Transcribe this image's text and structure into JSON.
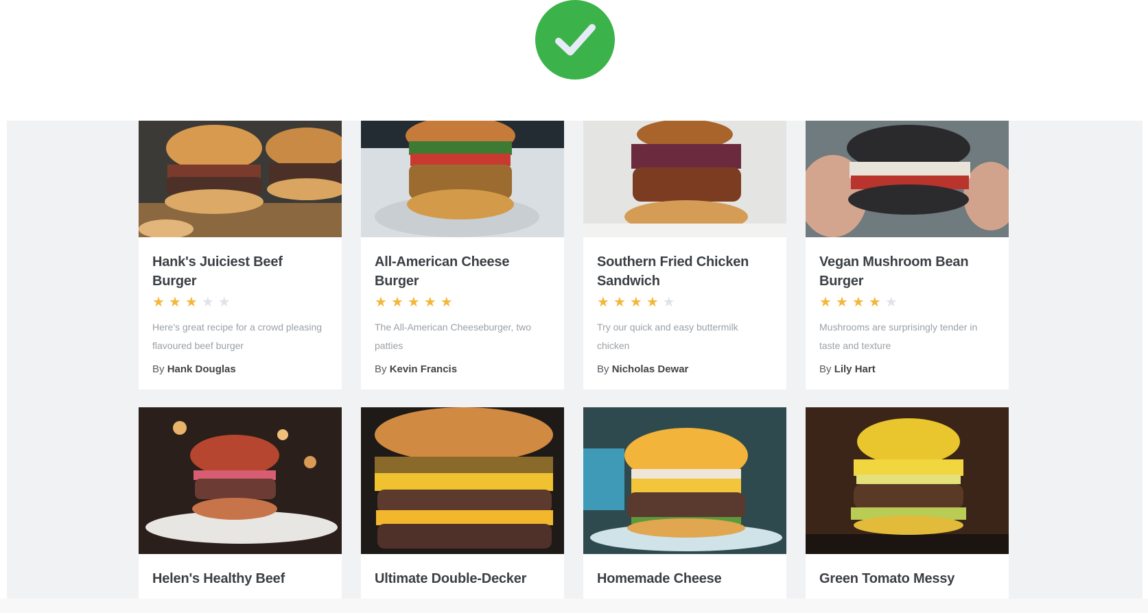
{
  "colors": {
    "check_badge": "#3bb24a",
    "panel_bg": "#f1f2f4",
    "star_on": "#f3b73b",
    "star_off": "#dfe3ea"
  },
  "badge": {
    "icon": "checkmark-icon"
  },
  "recipes": [
    {
      "title": "Hank's Juiciest Beef Burger",
      "rating": 3,
      "description": "Here's great recipe for a crowd pleasing flavoured beef burger",
      "author_prefix": "By",
      "author": "Hank Douglas"
    },
    {
      "title": "All-American Cheese Burger",
      "rating": 5,
      "description": "The All-American Cheeseburger, two patties",
      "author_prefix": "By",
      "author": "Kevin Francis"
    },
    {
      "title": "Southern Fried Chicken Sandwich",
      "rating": 4,
      "description": "Try our quick and easy buttermilk chicken",
      "author_prefix": "By",
      "author": "Nicholas Dewar"
    },
    {
      "title": "Vegan Mushroom Bean Burger",
      "rating": 4,
      "description": "Mushrooms are surprisingly tender in taste and texture",
      "author_prefix": "By",
      "author": "Lily Hart"
    },
    {
      "title": "Helen's Healthy Beef"
    },
    {
      "title": "Ultimate Double-Decker"
    },
    {
      "title": "Homemade Cheese"
    },
    {
      "title": "Green Tomato Messy"
    }
  ]
}
